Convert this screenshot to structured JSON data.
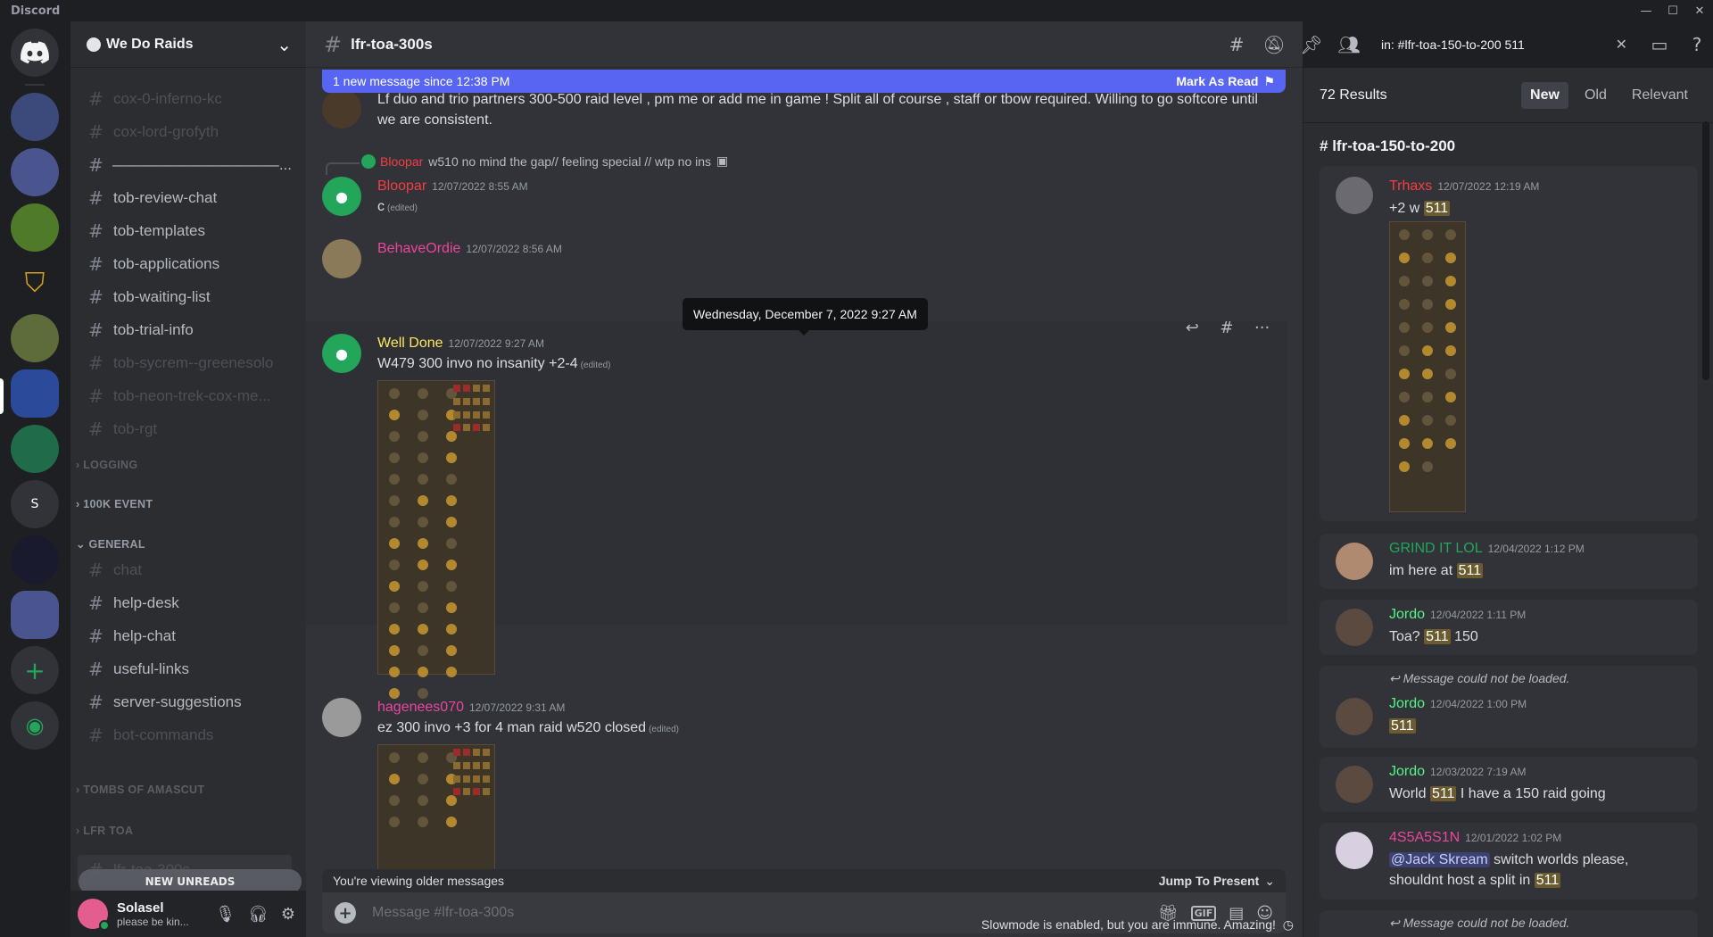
{
  "window": {
    "app_name": "Discord",
    "minimize": "—",
    "maximize": "☐",
    "close": "✕"
  },
  "guild": {
    "name": "We Do Raids",
    "chevron": "⌄"
  },
  "channels": [
    {
      "name": "cox-0-inferno-kc",
      "state": "dim"
    },
    {
      "name": "cox-lord-grofyth",
      "state": "dim"
    },
    {
      "name": "———————————...",
      "state": "bright"
    },
    {
      "name": "tob-review-chat",
      "state": "bright"
    },
    {
      "name": "tob-templates",
      "state": "bright"
    },
    {
      "name": "tob-applications",
      "state": "bright"
    },
    {
      "name": "tob-waiting-list",
      "state": "bright"
    },
    {
      "name": "tob-trial-info",
      "state": "bright"
    },
    {
      "name": "tob-sycrem--greenesolo",
      "state": "dim"
    },
    {
      "name": "tob-neon-trek-cox-me...",
      "state": "dim"
    },
    {
      "name": "tob-rgt",
      "state": "dim"
    },
    {
      "name": "chat",
      "state": "dim"
    },
    {
      "name": "help-desk",
      "state": "bright"
    },
    {
      "name": "help-chat",
      "state": "bright"
    },
    {
      "name": "useful-links",
      "state": "bright"
    },
    {
      "name": "server-suggestions",
      "state": "bright"
    },
    {
      "name": "bot-commands",
      "state": "dim"
    },
    {
      "name": "lfr-toa-300s",
      "state": "dim"
    }
  ],
  "categories": {
    "logging": "LOGGING",
    "event": "100K EVENT",
    "general": "GENERAL",
    "toa": "TOMBS OF AMASCUT",
    "lfr": "LFR TOA"
  },
  "new_unreads": "NEW UNREADS",
  "user": {
    "name": "Solasel",
    "status": "please be kin..."
  },
  "channel": {
    "name": "lfr-toa-300s"
  },
  "search": {
    "query": "in: #lfr-toa-150-to-200  511"
  },
  "new_message_bar": {
    "text": "1 new message since 12:38 PM",
    "action": "Mark As Read"
  },
  "messages": {
    "m0": {
      "text": "Lf duo and trio partners 300-500 raid level , pm me or add me in game ! Split all of course , staff or tbow required. Willing to go softcore until we are consistent."
    },
    "reply1": {
      "author": "Bloopar",
      "text": "w510 no mind the gap// feeling special // wtp no ins"
    },
    "m1": {
      "author": "Bloopar",
      "author_color": "#f23f43",
      "timestamp": "12/07/2022 8:55 AM",
      "text": "c",
      "edited": "(edited)"
    },
    "m2": {
      "author": "BehaveOrdie",
      "author_color": "#eb459e",
      "timestamp": "12/07/2022 8:56 AM"
    },
    "tooltip": "Wednesday, December 7, 2022 9:27 AM",
    "m3": {
      "author": "Well Done",
      "author_color": "#fee75c",
      "timestamp": "12/07/2022 9:27 AM",
      "text": "W479 300 invo no insanity +2-4",
      "edited": "(edited)"
    },
    "m4": {
      "author": "hagenees070",
      "author_color": "#eb459e",
      "timestamp": "12/07/2022 9:31 AM",
      "text": "ez 300 invo +3 for 4 man raid w520 closed",
      "edited": "(edited)"
    }
  },
  "older_bar": {
    "text": "You're viewing older messages",
    "action": "Jump To Present"
  },
  "composer": {
    "placeholder": "Message #lfr-toa-300s",
    "gif": "GIF"
  },
  "slowmode": "Slowmode is enabled, but you are immune. Amazing!",
  "results": {
    "count": "72 Results",
    "tabs": [
      "New",
      "Old",
      "Relevant"
    ],
    "channel": "lfr-toa-150-to-200",
    "items": [
      {
        "author": "Trhaxs",
        "color": "#f23f43",
        "timestamp": "12/07/2022 12:19 AM",
        "pre": "+2 w ",
        "hl": "511",
        "post": ""
      },
      {
        "author": "GRIND IT LOL",
        "color": "#23a55a",
        "timestamp": "12/04/2022 1:12 PM",
        "pre": "im here at ",
        "hl": "511",
        "post": ""
      },
      {
        "author": "Jordo",
        "color": "#57f287",
        "timestamp": "12/04/2022 1:11 PM",
        "pre": "Toa? ",
        "hl": "511",
        "post": " 150"
      },
      {
        "author": "Jordo",
        "color": "#57f287",
        "timestamp": "12/04/2022 1:00 PM",
        "pre": "",
        "hl": "511",
        "post": ""
      },
      {
        "author": "Jordo",
        "color": "#57f287",
        "timestamp": "12/03/2022 7:19 AM",
        "pre": "World ",
        "hl": "511",
        "post": " I have a 150 raid going"
      },
      {
        "author": "4S5A5S1N",
        "color": "#eb459e",
        "timestamp": "12/01/2022 1:02 PM",
        "mention": "@Jack Skream",
        "pre": " switch worlds please, shouldnt host a split in ",
        "hl": "511",
        "post": ""
      }
    ],
    "not_loaded": "Message could not be loaded."
  }
}
